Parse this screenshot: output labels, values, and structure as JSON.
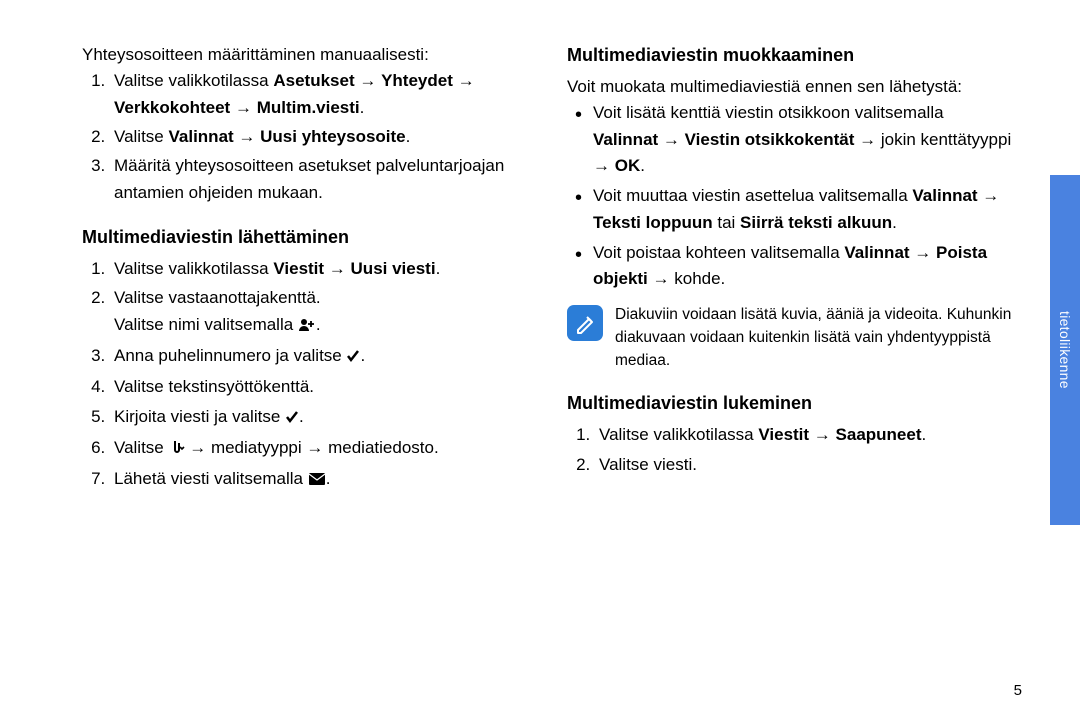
{
  "left": {
    "intro": "Yhteysosoitteen määrittäminen manuaalisesti:",
    "ol1": {
      "i1a": "Valitse valikkotilassa ",
      "i1b": "Asetukset",
      "arrow": " → ",
      "i1c": "Yhteydet",
      "i1d": "Verkkokohteet",
      "i1e": "Multim.viesti",
      "i2a": "Valitse ",
      "i2b": "Valinnat",
      "i2c": "Uusi yhteysosoite",
      "i3": "Määritä yhteysosoitteen asetukset palveluntarjoajan antamien ohjeiden mukaan."
    },
    "h2a": "Multimediaviestin lähettäminen",
    "ol2": {
      "i1a": "Valitse valikkotilassa ",
      "i1b": "Viestit",
      "i1c": "Uusi viesti",
      "i2a": "Valitse vastaanottajakenttä.",
      "i2b": "Valitse nimi valitsemalla ",
      "i3": "Anna puhelinnumero ja valitse ",
      "i4": "Valitse tekstinsyöttökenttä.",
      "i5": "Kirjoita viesti ja valitse ",
      "i6a": "Valitse ",
      "i6b": " → mediatyyppi → mediatiedosto.",
      "i7": "Lähetä viesti valitsemalla "
    }
  },
  "right": {
    "h2a": "Multimediaviestin muokkaaminen",
    "intro": "Voit muokata multimediaviestiä ennen sen lähetystä:",
    "ul": {
      "i1a": "Voit lisätä kenttiä viestin otsikkoon valitsemalla ",
      "i1b": "Valinnat",
      "i1c": "Viestin otsikkokentät",
      "i1d": " → jokin kenttätyyppi → ",
      "i1e": "OK",
      "i2a": "Voit muuttaa viestin asettelua valitsemalla ",
      "i2b": "Valinnat",
      "i2c": "Teksti loppuun",
      "i2d": " tai ",
      "i2e": "Siirrä teksti alkuun",
      "i3a": "Voit poistaa kohteen valitsemalla ",
      "i3b": "Valinnat",
      "i3c": "Poista objekti",
      "i3d": " → kohde."
    },
    "note": "Diakuviin voidaan lisätä kuvia, ääniä ja videoita. Kuhunkin diakuvaan voidaan kuitenkin lisätä vain yhdentyyppistä mediaa.",
    "h2b": "Multimediaviestin lukeminen",
    "ol": {
      "i1a": "Valitse valikkotilassa ",
      "i1b": "Viestit",
      "i1c": "Saapuneet",
      "i2": "Valitse viesti."
    }
  },
  "sidetab": "tietoliikenne",
  "pagenum": "5"
}
